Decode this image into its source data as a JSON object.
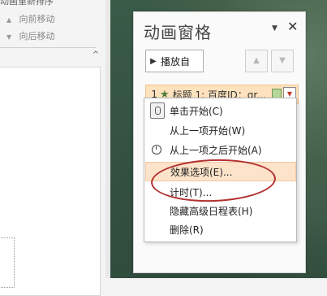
{
  "left_pane": {
    "cut_text": "动画重新排序",
    "move_forward": "向前移动",
    "move_backward": "向后移动"
  },
  "animation_pane": {
    "title": "动画窗格",
    "play_button": "播放自",
    "item": {
      "number": "1",
      "label": "标题 1: 百度ID：qr..."
    },
    "context_menu": [
      {
        "label": "单击开始(C)",
        "icon": "mouse-icon"
      },
      {
        "label": "从上一项开始(W)",
        "icon": ""
      },
      {
        "label": "从上一项之后开始(A)",
        "icon": "clock-icon"
      },
      {
        "label": "效果选项(E)...",
        "icon": "",
        "highlighted": true
      },
      {
        "label": "计时(T)...",
        "icon": ""
      },
      {
        "label": "隐藏高级日程表(H)",
        "icon": ""
      },
      {
        "label": "删除(R)",
        "icon": ""
      }
    ]
  },
  "colors": {
    "item_highlight": "#fde2bd",
    "annotation_circle": "#b23030"
  }
}
